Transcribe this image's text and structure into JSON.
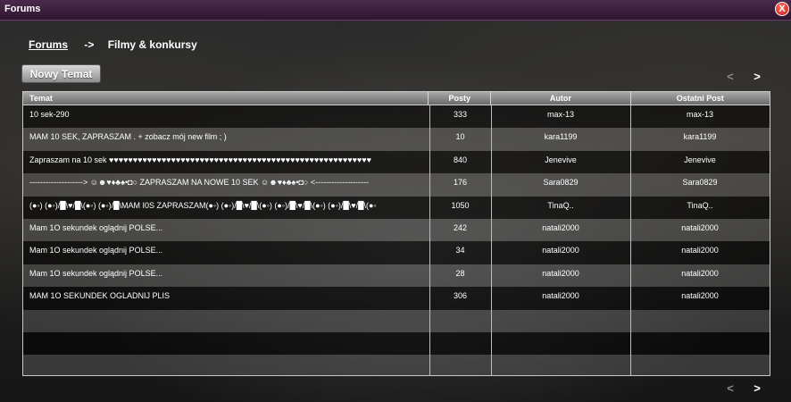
{
  "window": {
    "title": "Forums",
    "close_label": "X"
  },
  "breadcrumb": {
    "root": "Forums",
    "separator": "->",
    "current": "Filmy & konkursy"
  },
  "toolbar": {
    "new_topic_label": "Nowy Temat"
  },
  "pager": {
    "prev": "<",
    "next": ">"
  },
  "table": {
    "headers": [
      "Temat",
      "Posty",
      "Autor",
      "Ostatni Post"
    ],
    "rows": [
      {
        "topic": "10 sek-290",
        "posts": "333",
        "author": "max-13",
        "last": "max-13"
      },
      {
        "topic": "MAM 10 SEK, ZAPRASZAM . + zobacz mój new film ; )",
        "posts": "10",
        "author": "kara1199",
        "last": "kara1199"
      },
      {
        "topic": "Zapraszam na 10 sek ♥♥♥♥♥♥♥♥♥♥♥♥♥♥♥♥♥♥♥♥♥♥♥♥♥♥♥♥♥♥♥♥♥♥♥♥♥♥♥♥♥♥♥♥♥♥♥♥♥♥♥♥♥♥♥",
        "posts": "840",
        "author": "Jenevive",
        "last": "Jenevive"
      },
      {
        "topic": "--------------------> ☺☻♥♦♣♠•◘○ ZAPRASZAM NA NOWE 10 SEK ☺☻♥♦♣♠•◘○ <--------------------",
        "posts": "176",
        "author": "Sara0829",
        "last": "Sara0829"
      },
      {
        "topic": "(●◦) (●◦)/█\\♥/█\\(●◦) (●◦)/█\\MAM I0S ZAPRASZAM(●◦) (●◦)/█\\♥/█\\(●◦) (●◦)/█\\♥/█\\(●◦) (●◦)/█\\♥/█\\(●◦",
        "posts": "1050",
        "author": "TinaQ..",
        "last": "TinaQ.."
      },
      {
        "topic": "Mam 1O sekundek oglądnij POLSE...",
        "posts": "242",
        "author": "natali2000",
        "last": "natali2000"
      },
      {
        "topic": "Mam 1O sekundek oglądnij POLSE...",
        "posts": "34",
        "author": "natali2000",
        "last": "natali2000"
      },
      {
        "topic": "Mam 1O sekundek oglądnij POLSE...",
        "posts": "28",
        "author": "natali2000",
        "last": "natali2000"
      },
      {
        "topic": "MAM 1O SEKUNDEK OGLADNIJ PLIS",
        "posts": "306",
        "author": "natali2000",
        "last": "natali2000"
      },
      {
        "topic": "",
        "posts": "",
        "author": "",
        "last": ""
      },
      {
        "topic": "",
        "posts": "",
        "author": "",
        "last": ""
      },
      {
        "topic": "",
        "posts": "",
        "author": "",
        "last": ""
      }
    ]
  }
}
